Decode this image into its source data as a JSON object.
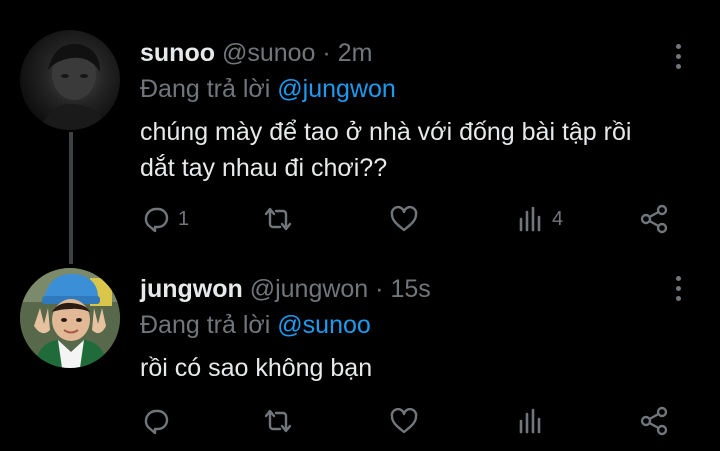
{
  "tweets": [
    {
      "display_name": "sunoo",
      "handle": "@sunoo",
      "separator": "·",
      "time": "2m",
      "reply_prefix": "Đang trả lời",
      "reply_to": "@jungwon",
      "text": "chúng mày để tao ở nhà với đống bài tập rồi dắt tay nhau đi chơi??",
      "reply_count": "1",
      "view_count": "4"
    },
    {
      "display_name": "jungwon",
      "handle": "@jungwon",
      "separator": "·",
      "time": "15s",
      "reply_prefix": "Đang trả lời",
      "reply_to": "@sunoo",
      "text": "rồi có sao không bạn",
      "reply_count": "",
      "view_count": ""
    }
  ],
  "icons": {
    "reply": "reply-icon",
    "retweet": "retweet-icon",
    "like": "heart-icon",
    "views": "views-chart-icon",
    "share": "share-icon",
    "more": "more-vertical-icon"
  },
  "colors": {
    "background": "#000000",
    "text": "#e7e9ea",
    "secondary": "#71767b",
    "link": "#1d9bf0",
    "thread_line": "#3e4144"
  }
}
